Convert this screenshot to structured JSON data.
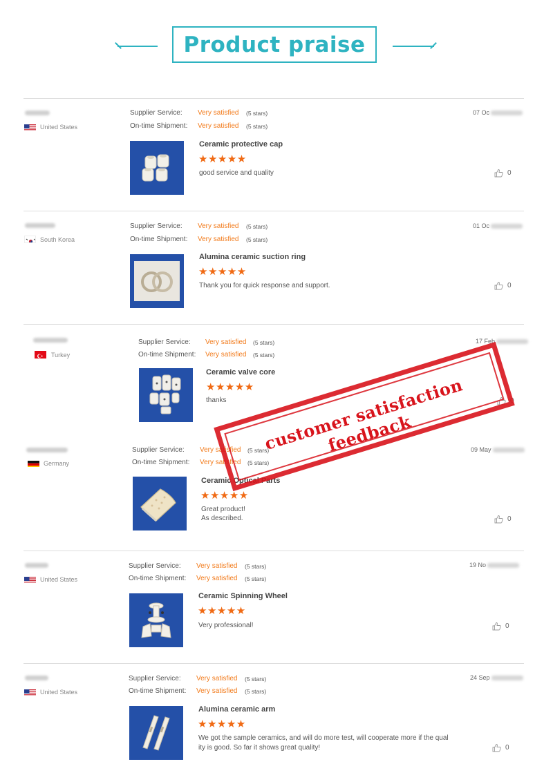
{
  "header": {
    "title": "Product praise",
    "accent_color": "#2eb3c1"
  },
  "stamp": {
    "text": "customer satisfaction feedback",
    "color": "#d8141c"
  },
  "labels": {
    "supplier_service": "Supplier Service:",
    "ontime_shipment": "On-time Shipment:"
  },
  "reviews": [
    {
      "country": "United States",
      "flag": "us-flag",
      "date": "07 Oc",
      "supplier_rating": "Very satisfied",
      "supplier_note": "(5 stars)",
      "shipment_rating": "Very satisfied",
      "shipment_note": "(5 stars)",
      "product": "Ceramic protective cap",
      "stars": "★★★★★",
      "comment": "good service and quality",
      "likes": "0",
      "thumb_icon": "ceramic-cap-image"
    },
    {
      "country": "South Korea",
      "flag": "kr-flag",
      "date": "01 Oc",
      "supplier_rating": "Very satisfied",
      "supplier_note": "(5 stars)",
      "shipment_rating": "Very satisfied",
      "shipment_note": "(5 stars)",
      "product": "Alumina ceramic suction ring",
      "stars": "★★★★★",
      "comment": "Thank you for quick response and support.",
      "likes": "0",
      "thumb_icon": "suction-ring-image"
    },
    {
      "country": "Turkey",
      "flag": "tr-flag",
      "date": "17 Feb",
      "supplier_rating": "Very satisfied",
      "supplier_note": "(5 stars)",
      "shipment_rating": "Very satisfied",
      "shipment_note": "(5 stars)",
      "product": "Ceramic valve core",
      "stars": "★★★★★",
      "comment": "thanks",
      "likes": "0",
      "thumb_icon": "valve-core-image"
    },
    {
      "country": "Germany",
      "flag": "de-flag",
      "date": "09 May",
      "supplier_rating": "Very satisfied",
      "supplier_note": "(5 stars)",
      "shipment_rating": "Very satisfied",
      "shipment_note": "(5 stars)",
      "product": "Ceramic Optical Parts",
      "stars": "★★★★★",
      "comment": "Great product!",
      "comment2": "As described.",
      "likes": "0",
      "thumb_icon": "optical-part-image"
    },
    {
      "country": "United States",
      "flag": "us-flag",
      "date": "19 No",
      "supplier_rating": "Very satisfied",
      "supplier_note": "(5 stars)",
      "shipment_rating": "Very satisfied",
      "shipment_note": "(5 stars)",
      "product": "Ceramic Spinning Wheel",
      "stars": "★★★★★",
      "comment": "Very professional!",
      "likes": "0",
      "thumb_icon": "spinning-wheel-image"
    },
    {
      "country": "United States",
      "flag": "us-flag",
      "date": "24 Sep",
      "supplier_rating": "Very satisfied",
      "supplier_note": "(5 stars)",
      "shipment_rating": "Very satisfied",
      "shipment_note": "(5 stars)",
      "product": "Alumina ceramic arm",
      "stars": "★★★★★",
      "comment": "We got the sample ceramics, and will do more test, will cooperate more if the qual",
      "comment2": "ity is good. So far it shows great quality!",
      "likes": "0",
      "thumb_icon": "ceramic-arm-image"
    }
  ]
}
